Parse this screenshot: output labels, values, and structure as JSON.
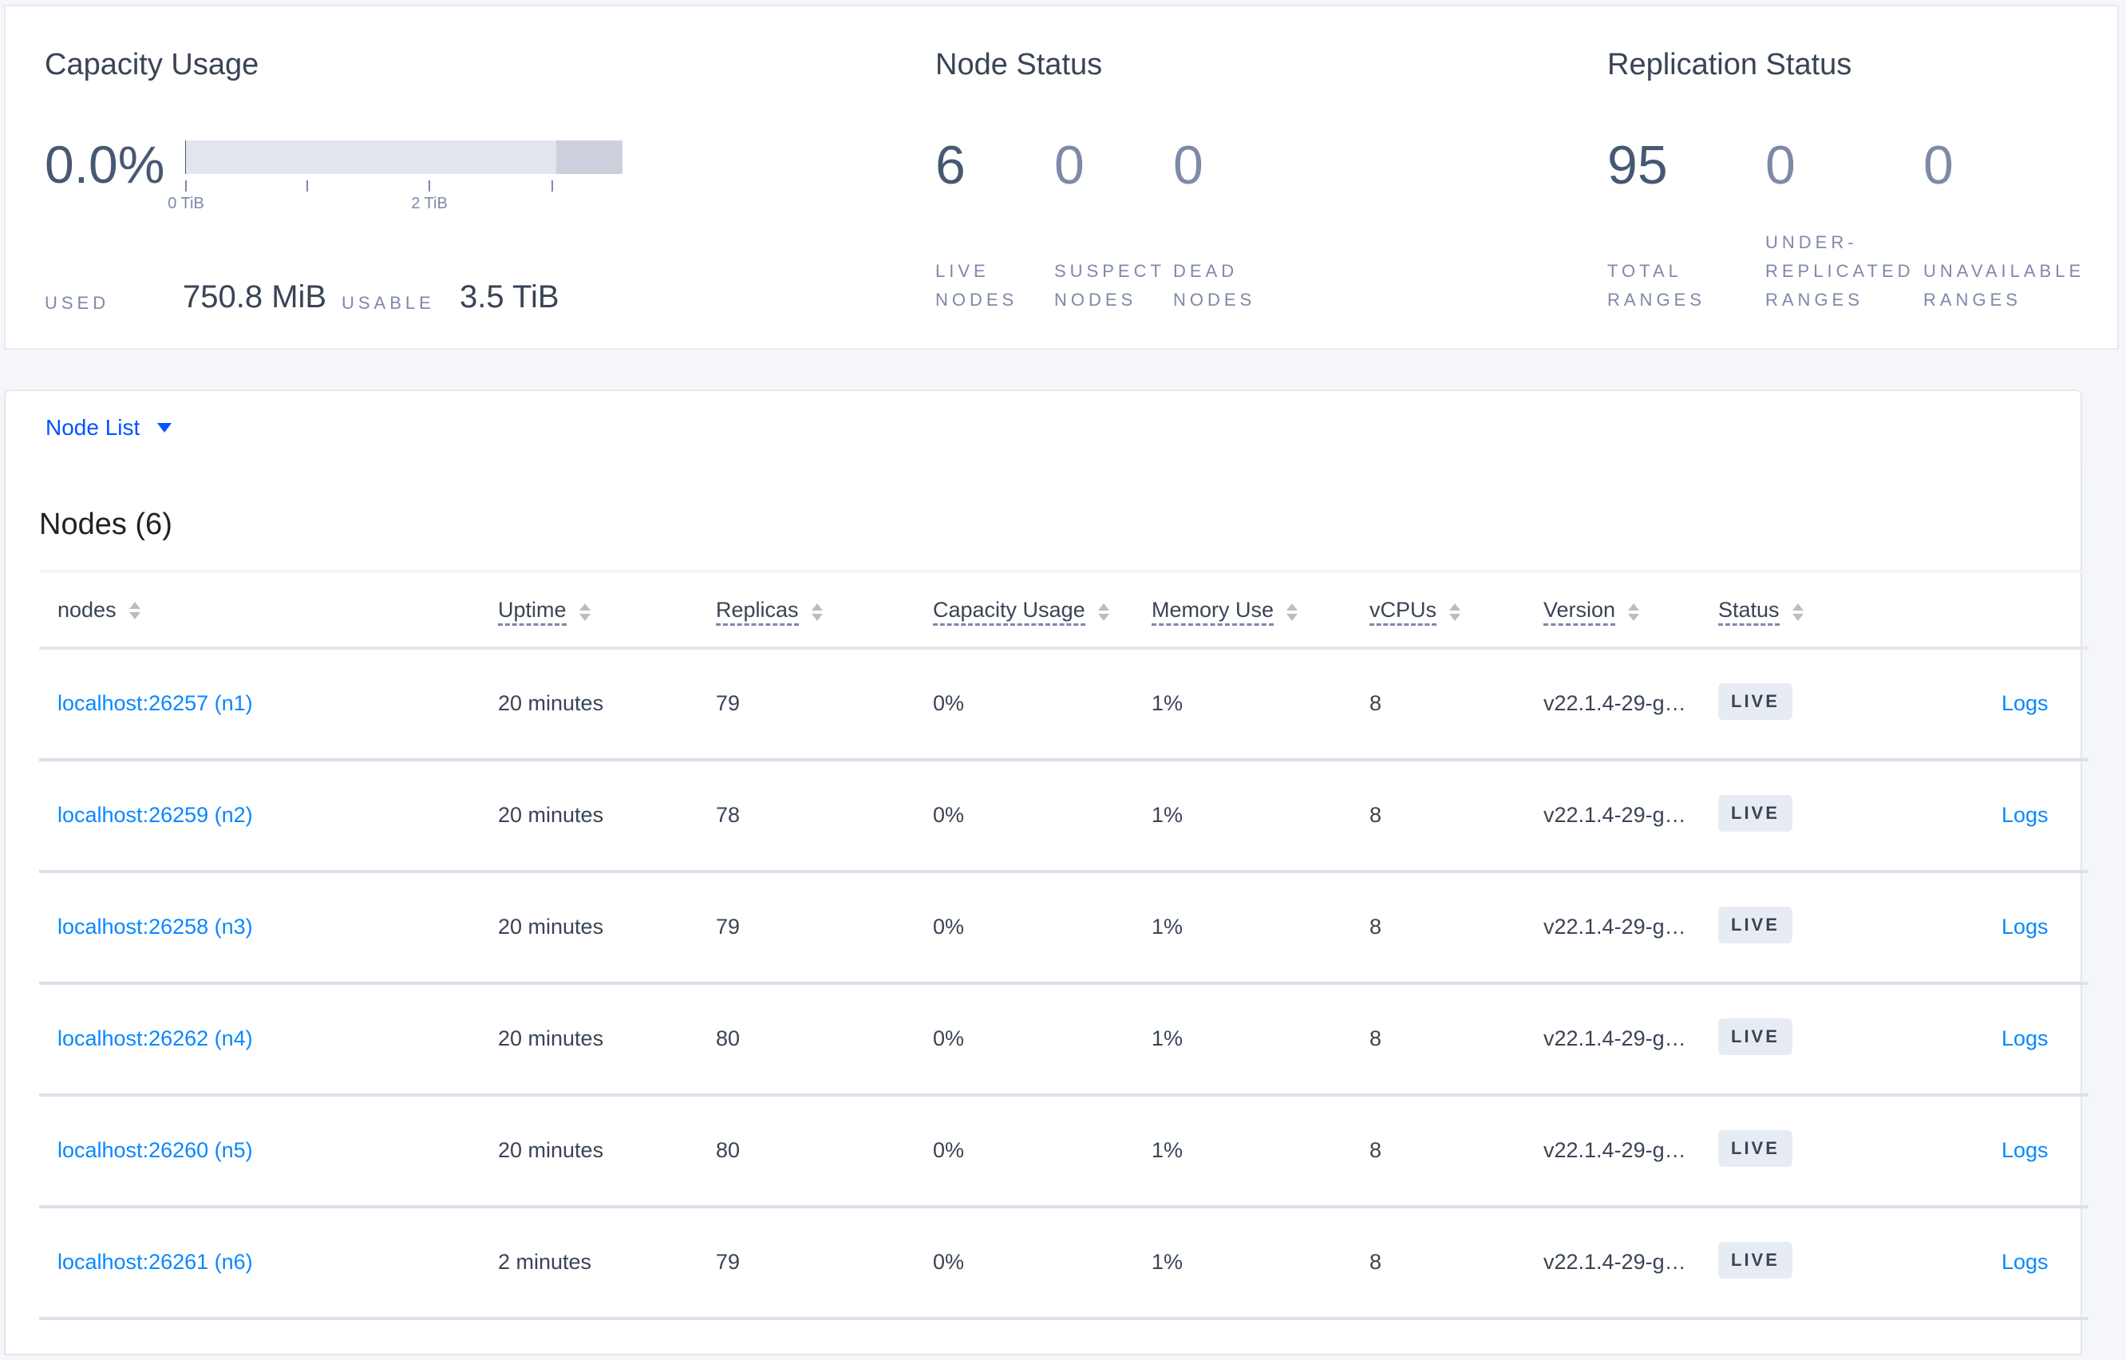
{
  "capacity": {
    "title": "Capacity Usage",
    "percent": "0.0%",
    "used_fraction": 0.0002,
    "ticks": [
      "0 TiB",
      "2 TiB"
    ],
    "used_label": "USED",
    "used_value": "750.8 MiB",
    "usable_label": "USABLE",
    "usable_value": "3.5 TiB"
  },
  "node_status": {
    "title": "Node Status",
    "stats": [
      {
        "value": "6",
        "label1": "LIVE",
        "label2": "NODES"
      },
      {
        "value": "0",
        "label1": "SUSPECT",
        "label2": "NODES"
      },
      {
        "value": "0",
        "label1": "DEAD",
        "label2": "NODES"
      }
    ]
  },
  "replication_status": {
    "title": "Replication Status",
    "stats": [
      {
        "value": "95",
        "label0": "",
        "label1": "TOTAL",
        "label2": "RANGES"
      },
      {
        "value": "0",
        "label0": "UNDER-",
        "label1": "REPLICATED",
        "label2": "RANGES"
      },
      {
        "value": "0",
        "label0": "",
        "label1": "UNAVAILABLE",
        "label2": "RANGES"
      }
    ]
  },
  "node_list": {
    "dropdown_label": "Node List",
    "title": "Nodes (6)",
    "columns": [
      "nodes",
      "Uptime",
      "Replicas",
      "Capacity Usage",
      "Memory Use",
      "vCPUs",
      "Version",
      "Status"
    ],
    "rows": [
      {
        "node": "localhost:26257 (n1)",
        "uptime": "20 minutes",
        "replicas": "79",
        "capacity": "0%",
        "memory": "1%",
        "vcpus": "8",
        "version": "v22.1.4-29-g…",
        "status": "LIVE",
        "logs": "Logs"
      },
      {
        "node": "localhost:26259 (n2)",
        "uptime": "20 minutes",
        "replicas": "78",
        "capacity": "0%",
        "memory": "1%",
        "vcpus": "8",
        "version": "v22.1.4-29-g…",
        "status": "LIVE",
        "logs": "Logs"
      },
      {
        "node": "localhost:26258 (n3)",
        "uptime": "20 minutes",
        "replicas": "79",
        "capacity": "0%",
        "memory": "1%",
        "vcpus": "8",
        "version": "v22.1.4-29-g…",
        "status": "LIVE",
        "logs": "Logs"
      },
      {
        "node": "localhost:26262 (n4)",
        "uptime": "20 minutes",
        "replicas": "80",
        "capacity": "0%",
        "memory": "1%",
        "vcpus": "8",
        "version": "v22.1.4-29-g…",
        "status": "LIVE",
        "logs": "Logs"
      },
      {
        "node": "localhost:26260 (n5)",
        "uptime": "20 minutes",
        "replicas": "80",
        "capacity": "0%",
        "memory": "1%",
        "vcpus": "8",
        "version": "v22.1.4-29-g…",
        "status": "LIVE",
        "logs": "Logs"
      },
      {
        "node": "localhost:26261 (n6)",
        "uptime": "2 minutes",
        "replicas": "79",
        "capacity": "0%",
        "memory": "1%",
        "vcpus": "8",
        "version": "v22.1.4-29-g…",
        "status": "LIVE",
        "logs": "Logs"
      }
    ]
  }
}
